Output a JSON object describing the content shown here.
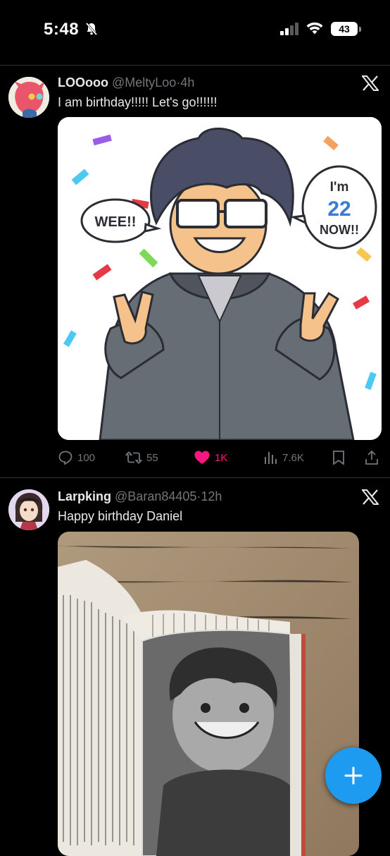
{
  "status_bar": {
    "time": "5:48",
    "battery": "43"
  },
  "tweets": [
    {
      "display_name": "LOOooo",
      "handle": "@MeltyLoo",
      "separator": "·",
      "time": "4h",
      "text": "I am birthday!!!!! Let's go!!!!!!",
      "media": {
        "bubble_left": "WEE!!",
        "bubble_right_line1": "I'm",
        "bubble_right_number": "22",
        "bubble_right_line3": "NOW!!"
      },
      "actions": {
        "replies": "100",
        "reposts": "55",
        "likes": "1K",
        "views": "7.6K"
      }
    },
    {
      "display_name": "Larpking",
      "handle": "@Baran84405",
      "separator": "·",
      "time": "12h",
      "text": "Happy birthday Daniel"
    }
  ],
  "icons": {
    "more": "x-logo-icon",
    "reply": "reply-icon",
    "repost": "repost-icon",
    "like": "heart-icon",
    "views": "views-icon",
    "bookmark": "bookmark-icon",
    "share": "share-icon",
    "compose": "plus-icon"
  },
  "colors": {
    "like": "#f91880",
    "accent": "#1d9bf0",
    "secondary_text": "#71767b"
  }
}
